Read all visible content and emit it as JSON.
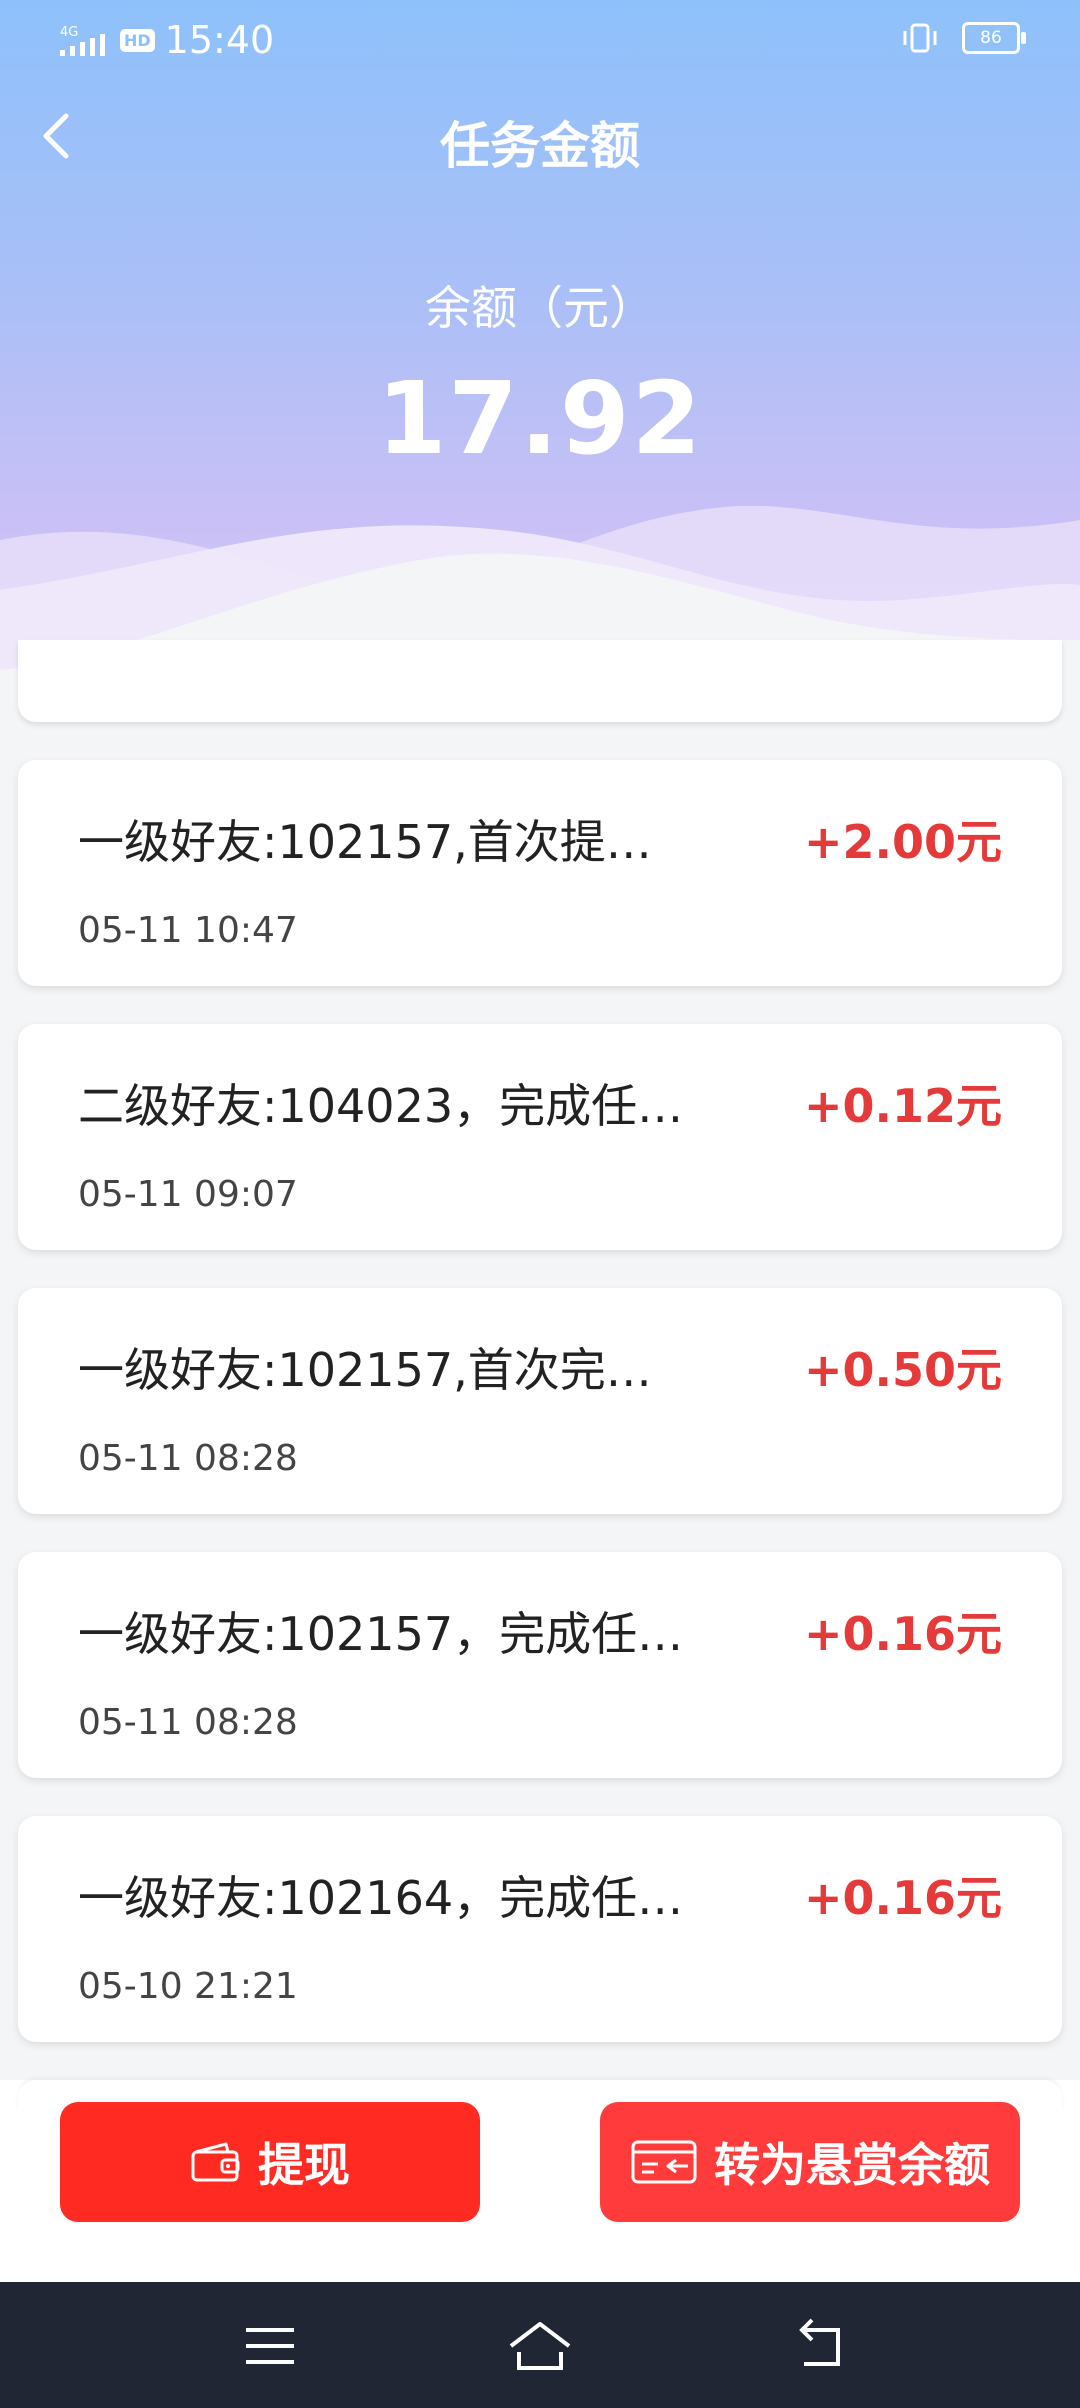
{
  "status": {
    "network": "4G",
    "hd": "HD",
    "time": "15:40",
    "battery": "86"
  },
  "header": {
    "title": "任务金额",
    "balance_label": "余额（元）",
    "balance_value": "17.92"
  },
  "records": [
    {
      "desc": "一级好友:102157,首次提…",
      "amount": "+2.00元",
      "time": "05-11 10:47"
    },
    {
      "desc": "二级好友:104023，完成任…",
      "amount": "+0.12元",
      "time": "05-11 09:07"
    },
    {
      "desc": "一级好友:102157,首次完…",
      "amount": "+0.50元",
      "time": "05-11 08:28"
    },
    {
      "desc": "一级好友:102157，完成任…",
      "amount": "+0.16元",
      "time": "05-11 08:28"
    },
    {
      "desc": "一级好友:102164，完成任…",
      "amount": "+0.16元",
      "time": "05-10 21:21"
    }
  ],
  "actions": {
    "withdraw_label": "提现",
    "transfer_label": "转为悬赏余额"
  },
  "colors": {
    "accent_red": "#ff2a22",
    "amount_red": "#e53a3a",
    "header_top": "#8ec1fb",
    "header_bottom": "#dacdf7"
  }
}
